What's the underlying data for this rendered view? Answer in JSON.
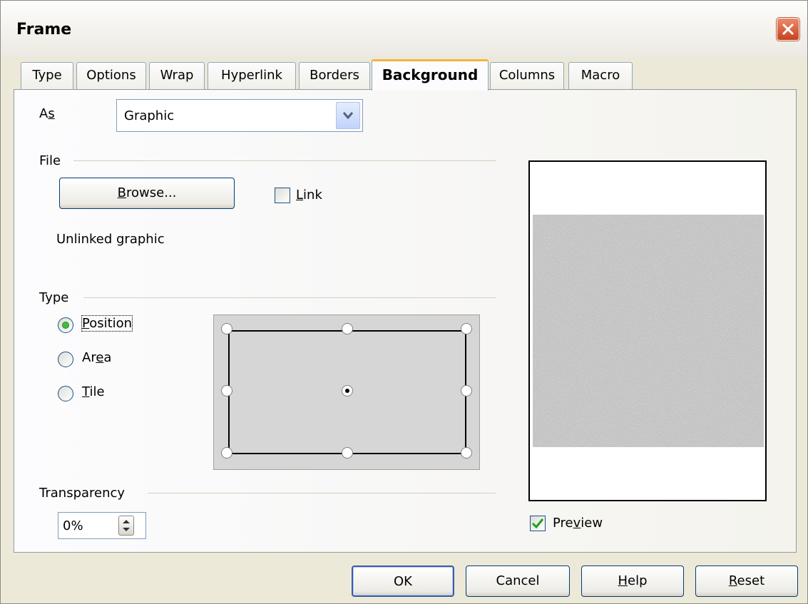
{
  "dialog": {
    "title": "Frame",
    "colors": {
      "title_bar": "#fdfdfb",
      "close_button": "#d55a35",
      "active_tab_accent": "#f4b33e",
      "radio_selected": "#3fbf3f"
    }
  },
  "tabs": [
    {
      "label": "Type"
    },
    {
      "label": "Options"
    },
    {
      "label": "Wrap"
    },
    {
      "label": "Hyperlink"
    },
    {
      "label": "Borders"
    },
    {
      "label": "Background",
      "active": true
    },
    {
      "label": "Columns"
    },
    {
      "label": "Macro"
    }
  ],
  "as": {
    "label_pre": "A",
    "label_key": "s",
    "value": "Graphic"
  },
  "file": {
    "section_label": "File",
    "browse_key": "B",
    "browse_rest": "rowse...",
    "link_key": "L",
    "link_rest": "ink",
    "link_checked": false,
    "status": "Unlinked graphic"
  },
  "type": {
    "section_label": "Type",
    "options": [
      {
        "key": "P",
        "rest": "osition",
        "selected": true
      },
      {
        "pre": "Ar",
        "key": "e",
        "rest": "a",
        "selected": false
      },
      {
        "key": "T",
        "rest": "ile",
        "selected": false
      }
    ],
    "position_selected": "center"
  },
  "transparency": {
    "section_label": "Transparency",
    "value": "0%"
  },
  "preview": {
    "pre": "Pre",
    "key": "v",
    "rest": "iew",
    "checked": true
  },
  "buttons": {
    "ok": "OK",
    "cancel": "Cancel",
    "help_key": "H",
    "help_rest": "elp",
    "reset_key": "R",
    "reset_rest": "eset"
  }
}
